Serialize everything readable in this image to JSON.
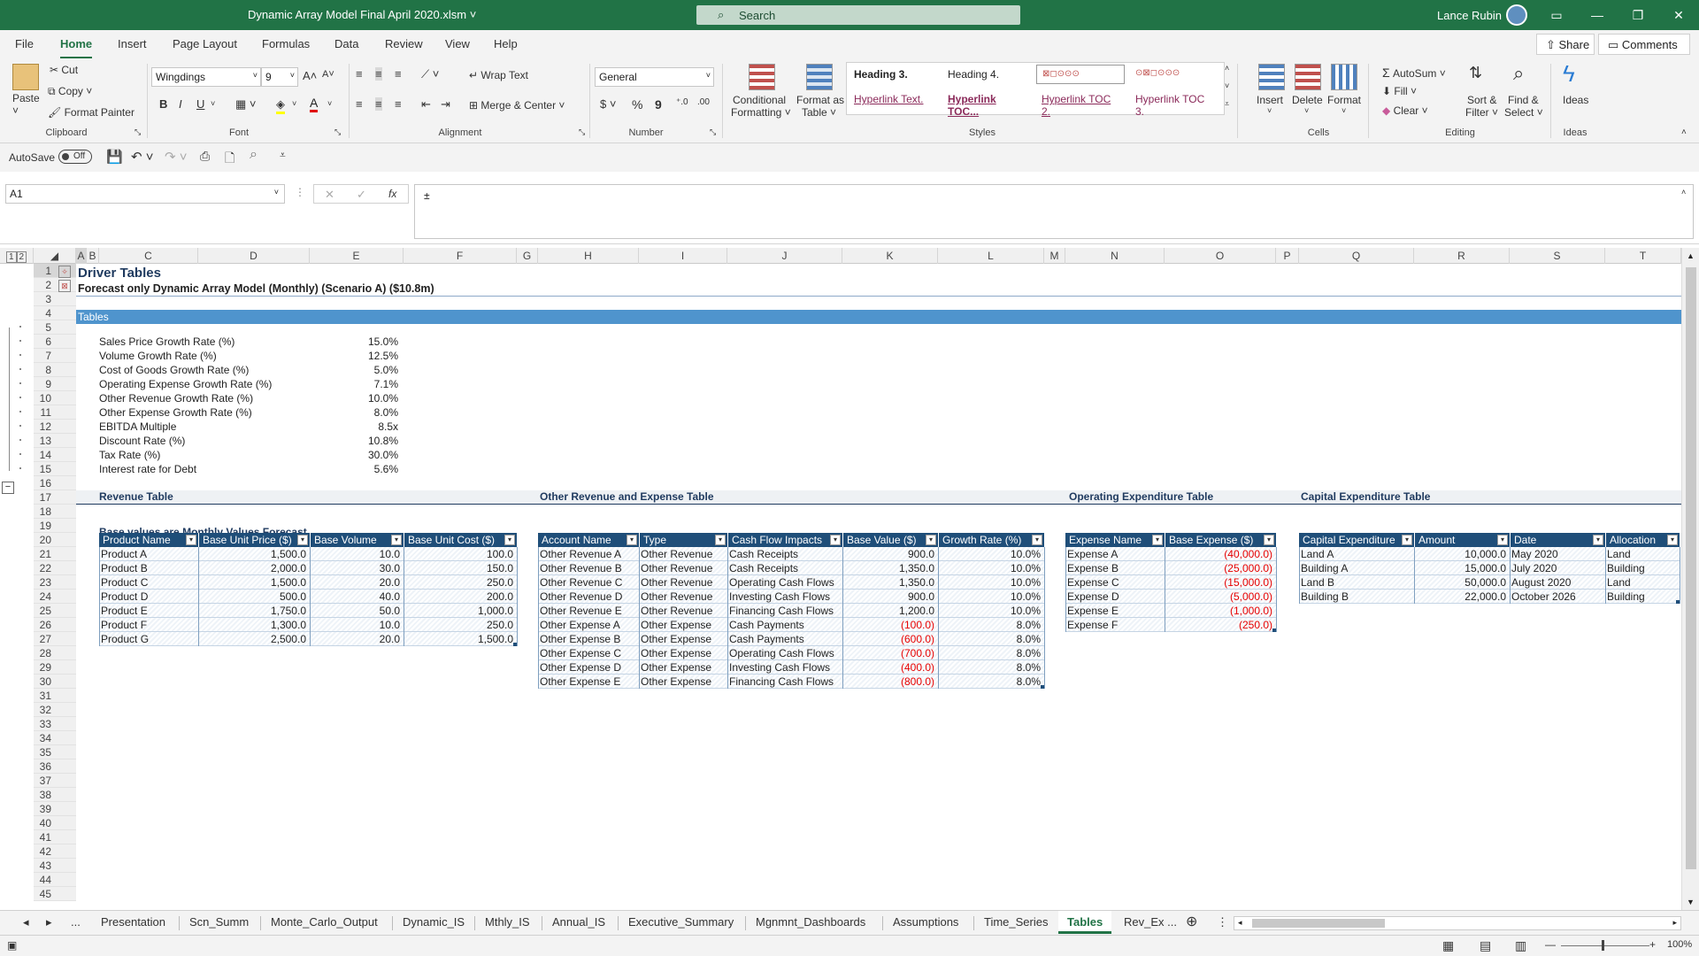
{
  "window": {
    "title": "Dynamic Array Model Final April 2020.xlsm",
    "search_placeholder": "Search",
    "user": "Lance Rubin"
  },
  "menu": {
    "tabs": [
      "File",
      "Home",
      "Insert",
      "Page Layout",
      "Formulas",
      "Data",
      "Review",
      "View",
      "Help"
    ],
    "active": "Home",
    "share": "Share",
    "comments": "Comments"
  },
  "ribbon": {
    "clipboard": {
      "paste": "Paste",
      "cut": "Cut",
      "copy": "Copy",
      "format_painter": "Format Painter",
      "label": "Clipboard"
    },
    "font": {
      "name": "Wingdings",
      "size": "9",
      "label": "Font"
    },
    "alignment": {
      "wrap": "Wrap Text",
      "merge": "Merge & Center",
      "label": "Alignment"
    },
    "number": {
      "format": "General",
      "label": "Number"
    },
    "styles": {
      "conditional": "Conditional",
      "formatting": "Formatting",
      "format_as": "Format as",
      "table": "Table",
      "h3": "Heading 3.",
      "h4": "Heading 4.",
      "hl": "Hyperlink Text.",
      "hltoc": "Hyperlink TOC...",
      "hltoc2": "Hyperlink TOC 2.",
      "hltoc3": "Hyperlink TOC 3.",
      "label": "Styles"
    },
    "cells": {
      "insert": "Insert",
      "delete": "Delete",
      "format": "Format",
      "label": "Cells"
    },
    "editing": {
      "autosum": "AutoSum",
      "fill": "Fill",
      "clear": "Clear",
      "sort": "Sort &",
      "filter": "Filter",
      "find": "Find &",
      "select": "Select",
      "label": "Editing"
    },
    "ideas": {
      "ideas": "Ideas",
      "label": "Ideas"
    }
  },
  "qat": {
    "autosave": "AutoSave",
    "autosave_state": "Off"
  },
  "formula_bar": {
    "name_box": "A1",
    "content": "±"
  },
  "columns": [
    "A",
    "B",
    "C",
    "D",
    "E",
    "F",
    "G",
    "H",
    "I",
    "J",
    "K",
    "L",
    "M",
    "N",
    "O",
    "P",
    "Q",
    "R",
    "S",
    "T"
  ],
  "rows": [
    "1",
    "2",
    "3",
    "4",
    "5",
    "6",
    "7",
    "8",
    "9",
    "10",
    "11",
    "12",
    "13",
    "14",
    "15",
    "16",
    "17",
    "18",
    "19",
    "20",
    "21",
    "22",
    "23",
    "24",
    "25",
    "26",
    "27",
    "28",
    "29",
    "30",
    "31",
    "32",
    "33",
    "34",
    "35",
    "36",
    "37",
    "38",
    "39",
    "40",
    "41",
    "42",
    "43",
    "44",
    "45"
  ],
  "sheet": {
    "title": "Driver Tables",
    "subtitle": "Forecast only Dynamic Array Model (Monthly) (Scenario A) ($10.8m)",
    "banner": "Tables",
    "drivers": [
      {
        "label": "Sales Price Growth Rate (%)",
        "value": "15.0%"
      },
      {
        "label": "Volume Growth Rate (%)",
        "value": "12.5%"
      },
      {
        "label": "Cost of Goods Growth Rate (%)",
        "value": "5.0%"
      },
      {
        "label": "Operating Expense Growth Rate (%)",
        "value": "7.1%"
      },
      {
        "label": "Other Revenue Growth Rate (%)",
        "value": "10.0%"
      },
      {
        "label": "Other Expense Growth Rate (%)",
        "value": "8.0%"
      },
      {
        "label": "EBITDA Multiple",
        "value": "8.5x"
      },
      {
        "label": "Discount Rate (%)",
        "value": "10.8%"
      },
      {
        "label": "Tax Rate (%)",
        "value": "30.0%"
      },
      {
        "label": "Interest rate for Debt",
        "value": "5.6%"
      }
    ],
    "revenue": {
      "title": "Revenue Table",
      "note": "Base values are Monthly Values Forecast",
      "headers": [
        "Product Name",
        "Base Unit Price ($)",
        "Base Volume",
        "Base Unit Cost ($)"
      ],
      "rows": [
        [
          "Product A",
          "1,500.0",
          "10.0",
          "100.0"
        ],
        [
          "Product B",
          "2,000.0",
          "30.0",
          "150.0"
        ],
        [
          "Product C",
          "1,500.0",
          "20.0",
          "250.0"
        ],
        [
          "Product D",
          "500.0",
          "40.0",
          "200.0"
        ],
        [
          "Product E",
          "1,750.0",
          "50.0",
          "1,000.0"
        ],
        [
          "Product F",
          "1,300.0",
          "10.0",
          "250.0"
        ],
        [
          "Product G",
          "2,500.0",
          "20.0",
          "1,500.0"
        ]
      ]
    },
    "other": {
      "title": "Other Revenue and Expense Table",
      "headers": [
        "Account Name",
        "Type",
        "Cash Flow Impacts",
        "Base Value ($)",
        "Growth Rate (%)"
      ],
      "rows": [
        [
          "Other Revenue A",
          "Other Revenue",
          "Cash Receipts",
          "900.0",
          "10.0%"
        ],
        [
          "Other Revenue B",
          "Other Revenue",
          "Cash Receipts",
          "1,350.0",
          "10.0%"
        ],
        [
          "Other Revenue C",
          "Other Revenue",
          "Operating Cash Flows",
          "1,350.0",
          "10.0%"
        ],
        [
          "Other Revenue D",
          "Other Revenue",
          "Investing Cash Flows",
          "900.0",
          "10.0%"
        ],
        [
          "Other Revenue E",
          "Other Revenue",
          "Financing Cash Flows",
          "1,200.0",
          "10.0%"
        ],
        [
          "Other Expense A",
          "Other Expense",
          "Cash Payments",
          "(100.0)",
          "8.0%"
        ],
        [
          "Other Expense B",
          "Other Expense",
          "Cash Payments",
          "(600.0)",
          "8.0%"
        ],
        [
          "Other Expense C",
          "Other Expense",
          "Operating Cash Flows",
          "(700.0)",
          "8.0%"
        ],
        [
          "Other Expense D",
          "Other Expense",
          "Investing Cash Flows",
          "(400.0)",
          "8.0%"
        ],
        [
          "Other Expense E",
          "Other Expense",
          "Financing Cash Flows",
          "(800.0)",
          "8.0%"
        ]
      ]
    },
    "opex": {
      "title": "Operating Expenditure Table",
      "headers": [
        "Expense Name",
        "Base Expense ($)"
      ],
      "rows": [
        [
          "Expense A",
          "(40,000.0)"
        ],
        [
          "Expense B",
          "(25,000.0)"
        ],
        [
          "Expense C",
          "(15,000.0)"
        ],
        [
          "Expense D",
          "(5,000.0)"
        ],
        [
          "Expense E",
          "(1,000.0)"
        ],
        [
          "Expense F",
          "(250.0)"
        ]
      ]
    },
    "capex": {
      "title": "Capital Expenditure Table",
      "headers": [
        "Capital Expenditure",
        "Amount",
        "Date",
        "Allocation"
      ],
      "rows": [
        [
          "Land A",
          "10,000.0",
          "May 2020",
          "Land"
        ],
        [
          "Building A",
          "15,000.0",
          "July 2020",
          "Building"
        ],
        [
          "Land B",
          "50,000.0",
          "August 2020",
          "Land"
        ],
        [
          "Building B",
          "22,000.0",
          "October 2026",
          "Building"
        ]
      ]
    }
  },
  "sheet_tabs": [
    "Presentation",
    "Scn_Summ",
    "Monte_Carlo_Output",
    "Dynamic_IS",
    "Mthly_IS",
    "Annual_IS",
    "Executive_Summary",
    "Mgnmnt_Dashboards",
    "Assumptions",
    "Time_Series",
    "Tables",
    "Rev_Ex ..."
  ],
  "active_sheet": "Tables",
  "status": {
    "zoom": "100%",
    "ellipsis": "..."
  }
}
